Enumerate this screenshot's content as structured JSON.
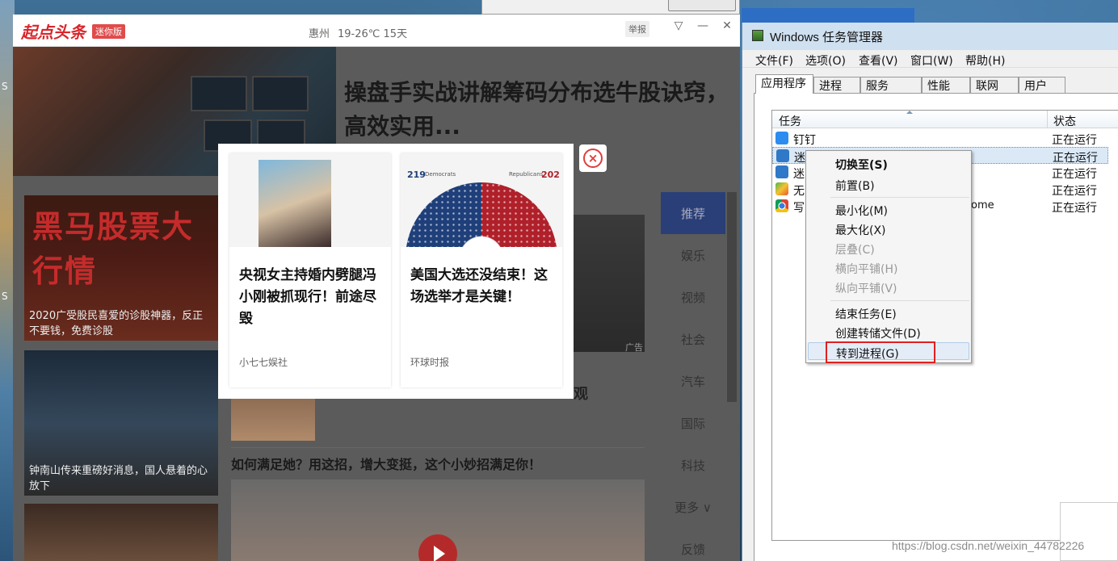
{
  "news_app": {
    "brand": "起点头条",
    "brand_badge": "迷你版",
    "city": "惠州",
    "weather": "19-26℃ 15天",
    "report": "举报",
    "hero_title": "操盘手实战讲解筹码分布选牛股诀窍，高效实用...",
    "cards": [
      {
        "banner": "黑马股票大行情",
        "caption": "2020广受股民喜爱的诊股神器，反正不要钱，免费诊股"
      },
      {
        "caption": "钟南山传来重磅好消息，国人悬着的心放下"
      }
    ],
    "ad_label": "广告",
    "partial_headline": "观",
    "headline2": "如何满足她？用这招，增大变挺，这个小妙招满足你！",
    "categories": [
      "推荐",
      "娱乐",
      "视频",
      "社会",
      "汽车",
      "国际",
      "科技",
      "更多 ∨",
      "反馈"
    ]
  },
  "popup": {
    "cards": [
      {
        "title": "央视女主持婚内劈腿冯小刚被抓现行！前途尽毁",
        "source": "小七七娱社"
      },
      {
        "title": "美国大选还没结束！这场选举才是关键！",
        "source": "环球时报",
        "dem_count": "219",
        "rep_count": "202",
        "dem_label": "Democrats",
        "rep_label": "Republicans"
      }
    ],
    "close_glyph": "×"
  },
  "taskmgr": {
    "title": "Windows 任务管理器",
    "menu": [
      "文件(F)",
      "选项(O)",
      "查看(V)",
      "窗口(W)",
      "帮助(H)"
    ],
    "tabs": [
      "应用程序",
      "进程",
      "服务",
      "性能",
      "联网",
      "用户"
    ],
    "columns": {
      "task": "任务",
      "status": "状态"
    },
    "rows": [
      {
        "name": "钉钉",
        "status": "正在运行",
        "icon": "dingtalk-icon"
      },
      {
        "name": "迷你",
        "status": "正在运行",
        "icon": "toutiao-icon"
      },
      {
        "name": "迷",
        "status": "正在运行",
        "icon": "toutiao-icon"
      },
      {
        "name": "无",
        "status": "正在运行",
        "icon": "ie-icon"
      },
      {
        "name": "写",
        "name_tail": "ome",
        "status": "正在运行",
        "icon": "chrome-icon"
      }
    ]
  },
  "context_menu": {
    "items": [
      {
        "label": "切换至(S)",
        "bold": true
      },
      {
        "label": "前置(B)"
      },
      {
        "label": "最小化(M)"
      },
      {
        "label": "最大化(X)"
      },
      {
        "label": "层叠(C)",
        "disabled": true
      },
      {
        "label": "横向平铺(H)",
        "disabled": true
      },
      {
        "label": "纵向平铺(V)",
        "disabled": true
      },
      {
        "label": "结束任务(E)"
      },
      {
        "label": "创建转储文件(D)"
      },
      {
        "label": "转到进程(G)",
        "highlighted": true
      }
    ]
  },
  "desktop_letters": [
    "S",
    "S"
  ],
  "watermark": "https://blog.csdn.net/weixin_44782226"
}
